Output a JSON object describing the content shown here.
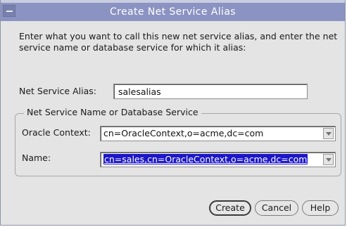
{
  "window": {
    "title": "Create Net Service Alias"
  },
  "instructions": "Enter what you want to call this new net service alias, and enter the net service name or database service for which it alias:",
  "alias": {
    "label": "Net Service Alias:",
    "value": "salesalias"
  },
  "group": {
    "legend": "Net Service Name or Database Service",
    "oracle_context": {
      "label": "Oracle Context:",
      "value": "cn=OracleContext,o=acme,dc=com"
    },
    "name": {
      "label": "Name:",
      "value": "cn=sales,cn=OracleContext,o=acme,dc=com"
    }
  },
  "buttons": {
    "create": "Create",
    "cancel": "Cancel",
    "help": "Help"
  },
  "colors": {
    "titlebar": "#8a93c2",
    "selection": "#1c16c8",
    "dialog_bg": "#e4e4e4"
  }
}
